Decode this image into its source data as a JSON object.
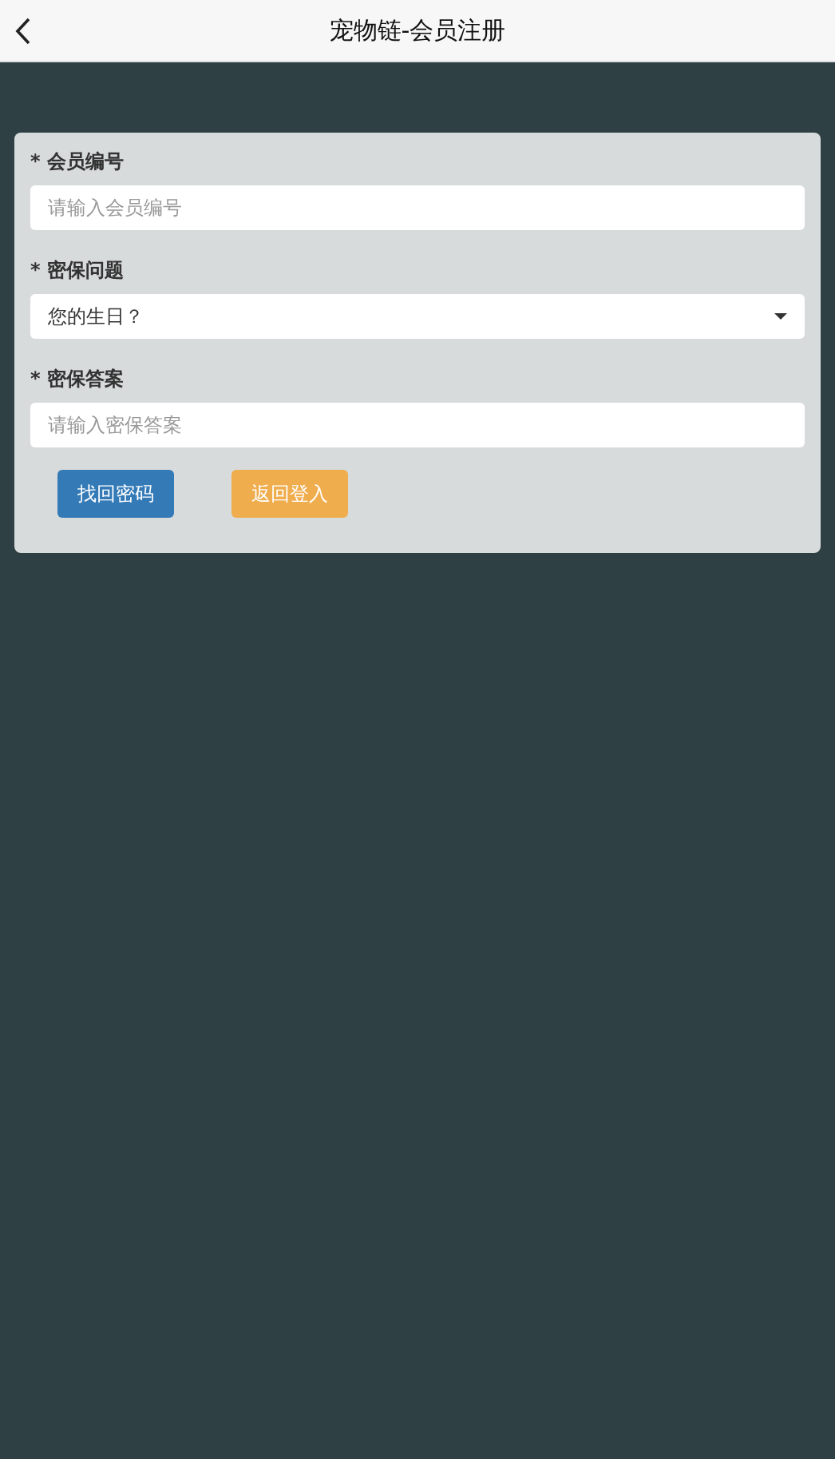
{
  "header": {
    "title": "宠物链-会员注册"
  },
  "form": {
    "fields": [
      {
        "kind": "input",
        "label": "* 会员编号",
        "placeholder": "请输入会员编号"
      },
      {
        "kind": "select",
        "label": "* 密保问题",
        "value": "您的生日？"
      },
      {
        "kind": "input",
        "label": "* 密保答案",
        "placeholder": "请输入密保答案"
      }
    ],
    "buttons": [
      {
        "kind": "primary",
        "label": "找回密码"
      },
      {
        "kind": "warning",
        "label": "返回登入"
      }
    ]
  }
}
